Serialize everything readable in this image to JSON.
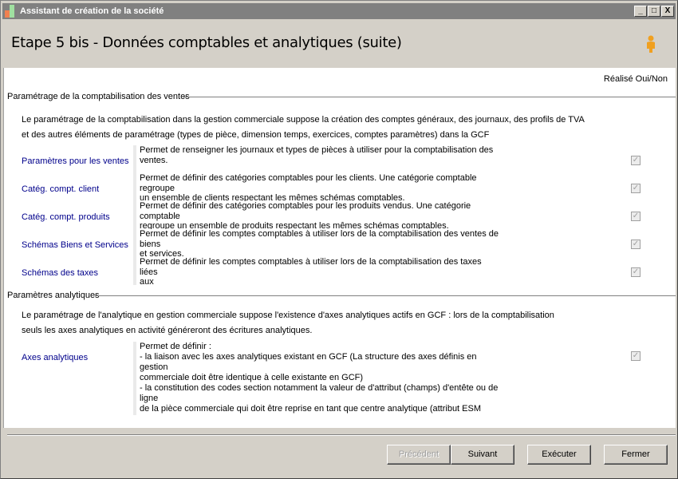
{
  "window": {
    "title": "Assistant de création de la société",
    "controls": [
      "_",
      "□",
      "X"
    ]
  },
  "header": {
    "title": "Etape 5 bis - Données comptables et analytiques (suite)",
    "icon": "person-icon"
  },
  "column_header": "Réalisé Oui/Non",
  "sales": {
    "group_title": "Paramétrage de la comptabilisation des ventes",
    "intro": [
      "Le paramétrage de la comptabilisation dans la gestion commerciale suppose la création des comptes généraux, des journaux, des profils de TVA",
      "et des autres éléments de paramétrage (types de pièce, dimension temps, exercices, comptes paramètres) dans la GCF"
    ],
    "items": [
      {
        "label": "Paramètres pour les ventes",
        "description": "Permet de renseigner les journaux et types de pièces à utiliser pour la comptabilisation des ventes.",
        "done": true
      },
      {
        "label": "Catég. compt. client",
        "description": "Permet de définir des catégories comptables pour les clients. Une catégorie comptable\nregroupe\nun ensemble de clients respectant les mêmes schémas comptables.",
        "done": true
      },
      {
        "label": "Catég. compt. produits",
        "description": "Permet de définir des catégories comptables pour les produits vendus. Une catégorie\ncomptable\nregroupe un ensemble de produits respectant les mêmes schémas comptables.",
        "done": true
      },
      {
        "label": "Schémas Biens et Services",
        "description": "Permet de définir les comptes comptables à utiliser lors de la comptabilisation des ventes de\nbiens\net services.",
        "done": true
      },
      {
        "label": "Schémas des taxes",
        "description": "Permet de définir les comptes comptables à utiliser lors de la comptabilisation des taxes liées\naux\nventes.",
        "done": true
      }
    ]
  },
  "analytics": {
    "group_title": "Paramètres analytiques",
    "intro": [
      "Le paramétrage de l'analytique en gestion commerciale suppose l'existence d'axes analytiques actifs en GCF : lors de la comptabilisation",
      "seuls les axes analytiques en activité généreront des écritures analytiques."
    ],
    "item": {
      "label": "Axes analytiques",
      "description": "Permet de définir :\n- la liaison avec les axes analytiques existant en GCF (La structure des axes définis en gestion\ncommerciale doit être identique à celle existante en GCF)\n- la constitution des codes section notamment la valeur de d'attribut (champs) d'entête ou de\nligne\nde la pièce commerciale qui doit être reprise en tant que centre analytique (attribut ESM\npossible).",
      "done": true
    }
  },
  "buttons": {
    "previous": "Précédent",
    "next": "Suivant",
    "execute": "Exécuter",
    "close": "Fermer"
  },
  "colors": {
    "link": "#00008b",
    "titlebar": "#808080",
    "face": "#d4d0c8"
  }
}
